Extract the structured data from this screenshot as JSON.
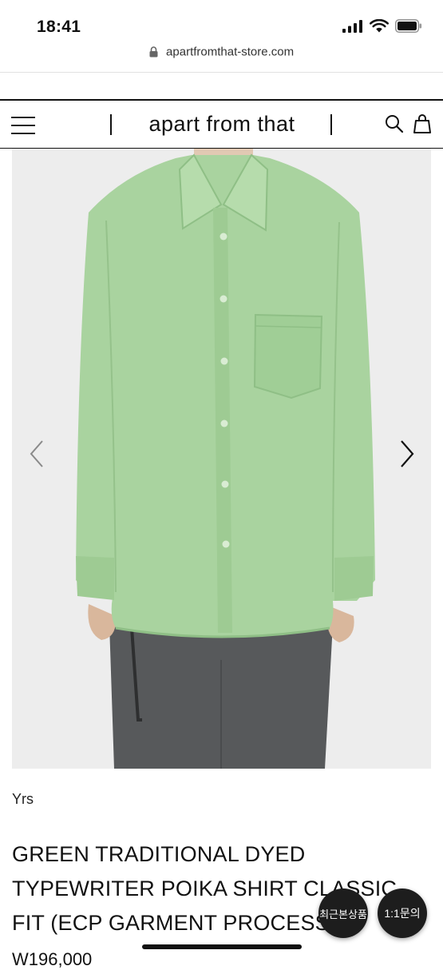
{
  "status_bar": {
    "time": "18:41",
    "signal_icon": "signal-bars-icon",
    "wifi_icon": "wifi-icon",
    "battery_icon": "battery-icon"
  },
  "browser": {
    "url": "apartfromthat-store.com",
    "lock_icon": "lock-icon"
  },
  "header": {
    "title": "apart from that",
    "menu_icon": "hamburger-menu-icon",
    "search_icon": "search-icon",
    "cart_icon": "shopping-bag-icon"
  },
  "gallery": {
    "prev_icon": "chevron-left-icon",
    "next_icon": "chevron-right-icon",
    "shirt_color": "#a9d39f",
    "trouser_color": "#57595b"
  },
  "product": {
    "brand": "Yrs",
    "title_lines": [
      "GREEN TRADITIONAL DYED",
      "TYPEWRITER POIKA SHIRT CLASSIC",
      "FIT (ECP GARMENT PROCESS"
    ],
    "price_partial": "W196,000"
  },
  "floating": {
    "recent_label": "최근본상품",
    "inquiry_label": "1:1문의"
  }
}
